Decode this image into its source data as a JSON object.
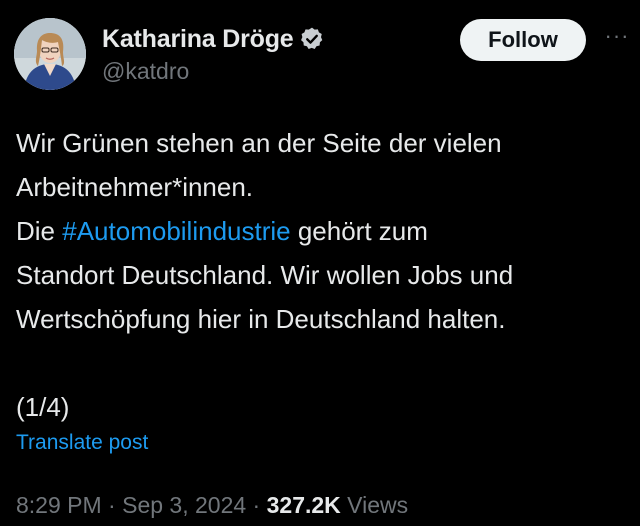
{
  "author": {
    "name": "Katharina Dröge",
    "handle": "@katdro",
    "verified": true
  },
  "actions": {
    "follow_label": "Follow",
    "more_label": "···"
  },
  "post": {
    "line1": "Wir Grünen stehen an der Seite der vielen",
    "line2": "Arbeitnehmer*innen.",
    "line3_prefix": "Die ",
    "hashtag": "#Automobilindustrie",
    "line3_suffix": " gehört zum",
    "line4": "Standort Deutschland. Wir wollen Jobs und",
    "line5": "Wertschöpfung hier in Deutschland halten.",
    "thread_marker": "(1/4)"
  },
  "translate_label": "Translate post",
  "meta": {
    "time": "8:29 PM",
    "separator": " · ",
    "date": "Sep 3, 2024",
    "views_count": "327.2K",
    "views_label": " Views"
  },
  "colors": {
    "background": "#000000",
    "text": "#e7e9ea",
    "secondary": "#71767b",
    "accent": "#1d9bf0",
    "follow_bg": "#eff3f4"
  },
  "icons": {
    "verified": "verified-badge-icon",
    "more": "more-horizontal-icon"
  }
}
